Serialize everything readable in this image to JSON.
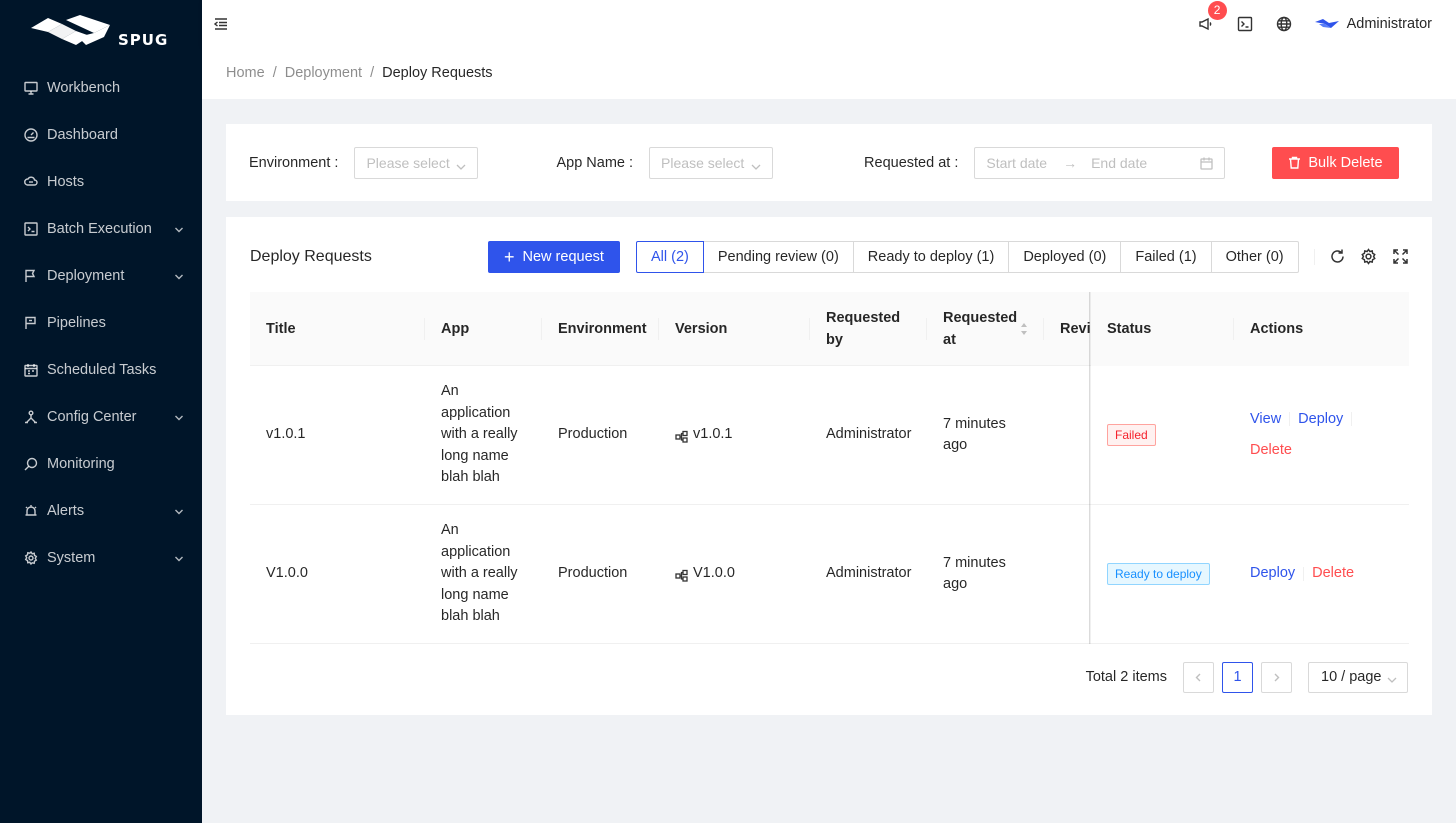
{
  "app": {
    "logo_text": "SPUG"
  },
  "sidebar": {
    "items": [
      {
        "label": "Workbench",
        "icon": "desktop-icon",
        "has_submenu": false
      },
      {
        "label": "Dashboard",
        "icon": "dashboard-icon",
        "has_submenu": false
      },
      {
        "label": "Hosts",
        "icon": "cloud-server-icon",
        "has_submenu": false
      },
      {
        "label": "Batch Execution",
        "icon": "code-icon",
        "has_submenu": true
      },
      {
        "label": "Deployment",
        "icon": "flag-icon",
        "has_submenu": true
      },
      {
        "label": "Pipelines",
        "icon": "pipeline-flag-icon",
        "has_submenu": false
      },
      {
        "label": "Scheduled Tasks",
        "icon": "schedule-icon",
        "has_submenu": false
      },
      {
        "label": "Config Center",
        "icon": "apartment-icon",
        "has_submenu": true
      },
      {
        "label": "Monitoring",
        "icon": "monitor-icon",
        "has_submenu": false
      },
      {
        "label": "Alerts",
        "icon": "alert-icon",
        "has_submenu": true
      },
      {
        "label": "System",
        "icon": "setting-icon",
        "has_submenu": true
      }
    ]
  },
  "header": {
    "notification_count": "2",
    "user_name": "Administrator"
  },
  "breadcrumb": {
    "items": [
      "Home",
      "Deployment"
    ],
    "current": "Deploy Requests"
  },
  "filters": {
    "environment_label": "Environment",
    "environment_placeholder": "Please select",
    "app_label": "App Name",
    "app_placeholder": "Please select",
    "requested_label": "Requested at",
    "start_placeholder": "Start date",
    "end_placeholder": "End date",
    "bulk_delete": "Bulk Delete"
  },
  "table_card": {
    "title": "Deploy Requests",
    "new_request": "New request",
    "tabs": [
      {
        "label": "All (2)",
        "active": true
      },
      {
        "label": "Pending review (0)",
        "active": false
      },
      {
        "label": "Ready to deploy (1)",
        "active": false
      },
      {
        "label": "Deployed (0)",
        "active": false
      },
      {
        "label": "Failed (1)",
        "active": false
      },
      {
        "label": "Other (0)",
        "active": false
      }
    ],
    "columns": {
      "title": "Title",
      "app": "App",
      "environment": "Environment",
      "version": "Version",
      "requested_by": "Requested by",
      "requested_at": "Requested at",
      "reviewer": "Revie",
      "status": "Status",
      "actions": "Actions"
    },
    "rows": [
      {
        "title": "v1.0.1",
        "app": "An application with a really long name blah blah",
        "environment": "Production",
        "version": "v1.0.1",
        "requested_by": "Administrator",
        "requested_at": "7 minutes ago",
        "reviewer": "",
        "status": "Failed",
        "actions": [
          "View",
          "Deploy",
          "Delete"
        ]
      },
      {
        "title": "V1.0.0",
        "app": "An application with a really long name blah blah",
        "environment": "Production",
        "version": "V1.0.0",
        "requested_by": "Administrator",
        "requested_at": "7 minutes ago",
        "reviewer": "",
        "status": "Ready to deploy",
        "actions": [
          "Deploy",
          "Delete"
        ]
      }
    ],
    "pagination": {
      "total": "Total 2 items",
      "current_page": "1",
      "page_size": "10 / page"
    }
  },
  "colors": {
    "sidebar_bg": "#001529",
    "primary": "#2f54eb",
    "danger": "#ff4d4f"
  }
}
